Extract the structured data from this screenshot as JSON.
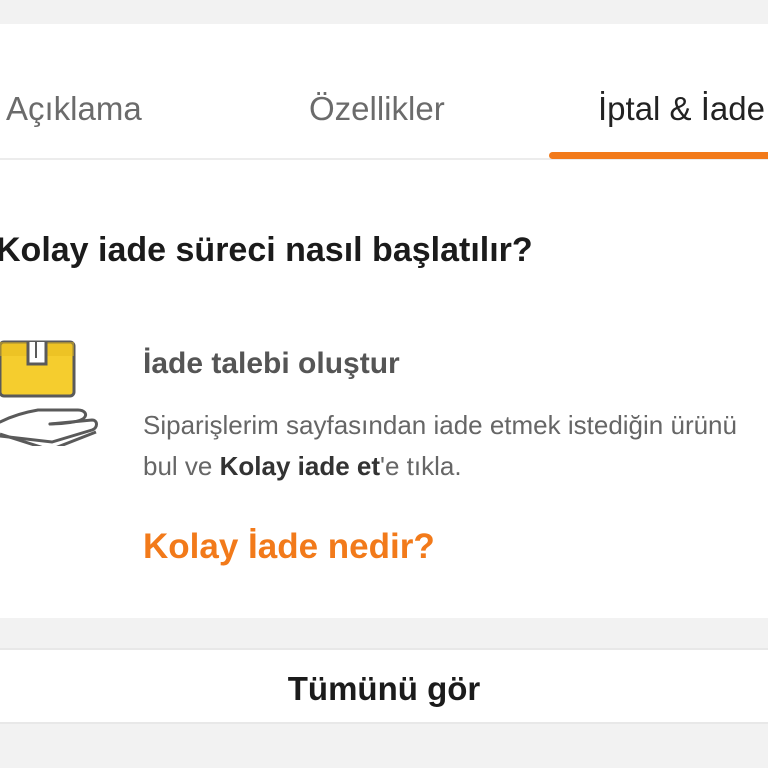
{
  "tabs": [
    {
      "label": "Açıklama"
    },
    {
      "label": "Özellikler"
    },
    {
      "label": "İptal & İade"
    }
  ],
  "active_tab_index": 2,
  "accent_color": "#f27a1a",
  "section": {
    "title": "Kolay iade süreci nasıl başlatılır?"
  },
  "step": {
    "icon": "package-on-hand-icon",
    "title": "İade talebi oluştur",
    "description_part1": "Siparişlerim sayfasından iade etmek istediğin ürünü bul ve ",
    "description_bold": "Kolay iade et",
    "description_part2": "'e tıkla."
  },
  "link": {
    "label": "Kolay İade nedir?"
  },
  "footer": {
    "see_all_label": "Tümünü gör"
  }
}
